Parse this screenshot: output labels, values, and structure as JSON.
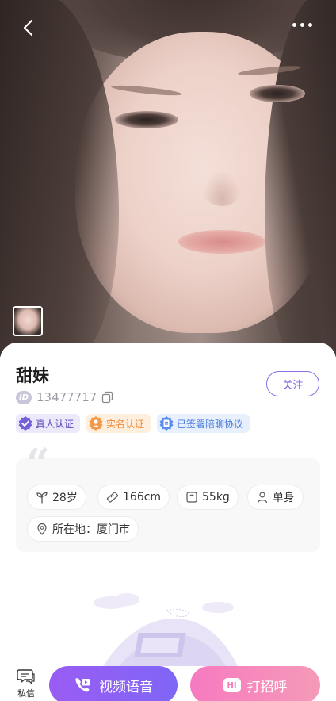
{
  "profile": {
    "name": "甜妹",
    "id_badge": "ID",
    "id_number": "13477717",
    "follow_label": "关注"
  },
  "tags": [
    {
      "label": "真人认证",
      "icon": "verified-shield-icon",
      "color": "#5b46b9"
    },
    {
      "label": "实名认证",
      "icon": "realname-badge-icon",
      "color": "#ef8b3b"
    },
    {
      "label": "已签署陪聊协议",
      "icon": "agreement-icon",
      "color": "#4a7ee0"
    }
  ],
  "info": {
    "quote_mark": "“",
    "age": "28岁",
    "height": "166cm",
    "weight": "55kg",
    "status": "单身",
    "location": "所在地：厦门市"
  },
  "actions": {
    "message_label": "私信",
    "video_label": "视频语音",
    "hi_label": "打招呼",
    "hi_icon_text": "HI"
  },
  "colors": {
    "accent_purple": "#7f66f6",
    "accent_pink": "#f67ac0"
  }
}
